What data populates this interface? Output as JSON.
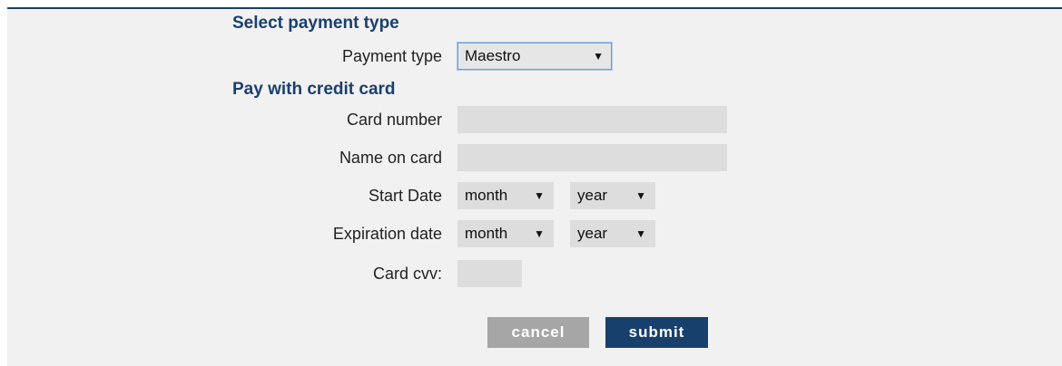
{
  "form": {
    "section_payment_type_title": "Select payment type",
    "payment_type_label": "Payment type",
    "payment_type_value": "Maestro",
    "section_credit_card_title": "Pay with credit card",
    "card_number_label": "Card number",
    "card_number_value": "",
    "name_on_card_label": "Name on card",
    "name_on_card_value": "",
    "start_date_label": "Start Date",
    "start_date_month": "month",
    "start_date_year": "year",
    "expiration_date_label": "Expiration date",
    "expiration_month": "month",
    "expiration_year": "year",
    "card_cvv_label": "Card cvv:",
    "card_cvv_value": ""
  },
  "buttons": {
    "cancel_label": "cancel",
    "submit_label": "submit"
  },
  "icons": {
    "dropdown_arrow": "▼"
  },
  "colors": {
    "heading": "#1a3f6e",
    "submit_bg": "#17406d",
    "cancel_bg": "#a6a6a6",
    "panel_bg": "#f1f1f1",
    "field_bg": "#dddddd"
  }
}
